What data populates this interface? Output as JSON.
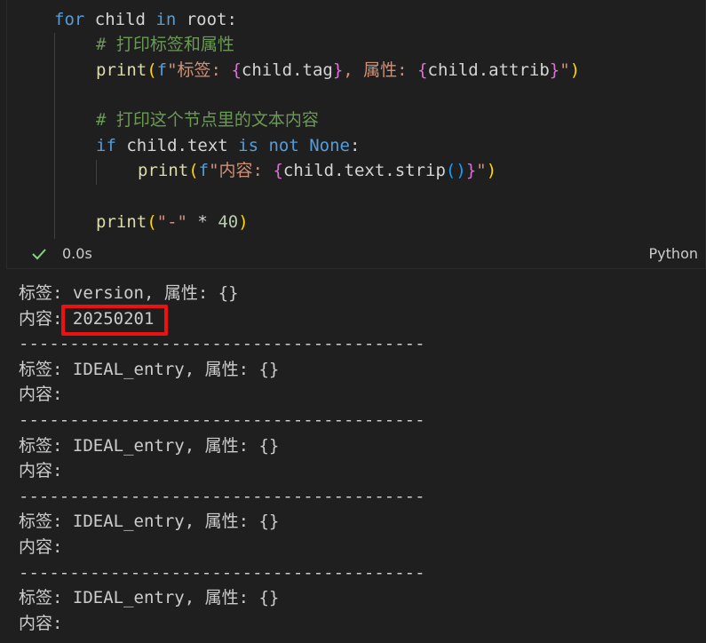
{
  "code_lines": [
    {
      "tokens": [
        {
          "t": "for",
          "c": "kw"
        },
        {
          "t": " child ",
          "c": "var"
        },
        {
          "t": "in",
          "c": "kw"
        },
        {
          "t": " root:",
          "c": "var"
        }
      ]
    },
    {
      "tokens": [
        {
          "t": "# 打印标签和属性",
          "c": "cm"
        }
      ]
    },
    {
      "tokens": [
        {
          "t": "print",
          "c": "fn"
        },
        {
          "t": "(",
          "c": "br1"
        },
        {
          "t": "f",
          "c": "fpre"
        },
        {
          "t": "\"标签: ",
          "c": "str"
        },
        {
          "t": "{",
          "c": "br2"
        },
        {
          "t": "child.tag",
          "c": "var"
        },
        {
          "t": "}",
          "c": "br2"
        },
        {
          "t": ", 属性: ",
          "c": "str"
        },
        {
          "t": "{",
          "c": "br2"
        },
        {
          "t": "child.attrib",
          "c": "var"
        },
        {
          "t": "}",
          "c": "br2"
        },
        {
          "t": "\"",
          "c": "str"
        },
        {
          "t": ")",
          "c": "br1"
        }
      ]
    },
    {
      "tokens": []
    },
    {
      "tokens": [
        {
          "t": "# 打印这个节点里的文本内容",
          "c": "cm"
        }
      ]
    },
    {
      "tokens": [
        {
          "t": "if",
          "c": "kw"
        },
        {
          "t": " child.text ",
          "c": "var"
        },
        {
          "t": "is not None",
          "c": "kw"
        },
        {
          "t": ":",
          "c": "var"
        }
      ]
    },
    {
      "tokens": [
        {
          "t": "print",
          "c": "fn"
        },
        {
          "t": "(",
          "c": "br1"
        },
        {
          "t": "f",
          "c": "fpre"
        },
        {
          "t": "\"内容: ",
          "c": "str"
        },
        {
          "t": "{",
          "c": "br2"
        },
        {
          "t": "child.text.strip",
          "c": "var"
        },
        {
          "t": "()",
          "c": "br3"
        },
        {
          "t": "}",
          "c": "br2"
        },
        {
          "t": "\"",
          "c": "str"
        },
        {
          "t": ")",
          "c": "br1"
        }
      ]
    },
    {
      "tokens": []
    },
    {
      "tokens": [
        {
          "t": "print",
          "c": "fn"
        },
        {
          "t": "(",
          "c": "br1"
        },
        {
          "t": "\"-\"",
          "c": "str"
        },
        {
          "t": " * ",
          "c": "op"
        },
        {
          "t": "40",
          "c": "num"
        },
        {
          "t": ")",
          "c": "br1"
        }
      ]
    }
  ],
  "status": {
    "time": "0.0s",
    "language": "Python"
  },
  "output_lines": [
    "标签: version, 属性: {}",
    "内容: 20250201",
    "----------------------------------------",
    "标签: IDEAL_entry, 属性: {}",
    "内容:",
    "----------------------------------------",
    "标签: IDEAL_entry, 属性: {}",
    "内容:",
    "----------------------------------------",
    "标签: IDEAL_entry, 属性: {}",
    "内容:",
    "----------------------------------------",
    "标签: IDEAL_entry, 属性: {}",
    "内容:"
  ],
  "colors": {
    "background": "#1f1f1f",
    "highlight_box": "#ee1111",
    "check": "#89d185"
  }
}
